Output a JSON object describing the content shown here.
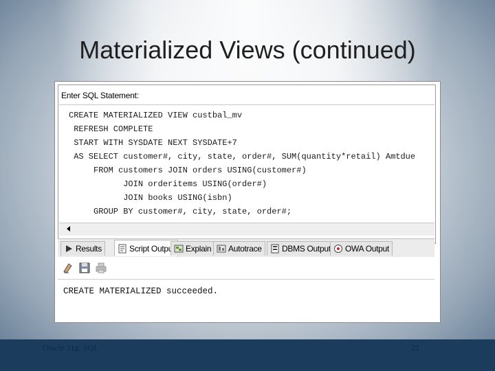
{
  "slide": {
    "title": "Materialized Views (continued)",
    "footer_left": "Oracle 11g: SQL",
    "page_number": "22"
  },
  "sql_pane": {
    "label": "Enter SQL Statement:",
    "lines": [
      "CREATE MATERIALIZED VIEW custbal_mv",
      " REFRESH COMPLETE",
      " START WITH SYSDATE NEXT SYSDATE+7",
      " AS SELECT customer#, city, state, order#, SUM(quantity*retail) Amtdue",
      "     FROM customers JOIN orders USING(customer#)",
      "           JOIN orderitems USING(order#)",
      "           JOIN books USING(isbn)",
      "     GROUP BY customer#, city, state, order#;"
    ]
  },
  "tabs": [
    {
      "label": "Results",
      "icon": "play-icon",
      "active": false
    },
    {
      "label": "Script Output",
      "icon": "script-icon",
      "active": true
    },
    {
      "label": "Explain",
      "icon": "explain-icon",
      "active": false
    },
    {
      "label": "Autotrace",
      "icon": "autotrace-icon",
      "active": false
    },
    {
      "label": "DBMS Output",
      "icon": "dbms-icon",
      "active": false
    },
    {
      "label": "OWA Output",
      "icon": "owa-icon",
      "active": false
    }
  ],
  "toolbar": {
    "buttons": [
      "eraser-icon",
      "save-icon",
      "print-icon"
    ]
  },
  "output": {
    "text": "CREATE MATERIALIZED succeeded."
  },
  "colors": {
    "footer": "#1c3c5e",
    "accent_red": "#c62828"
  }
}
